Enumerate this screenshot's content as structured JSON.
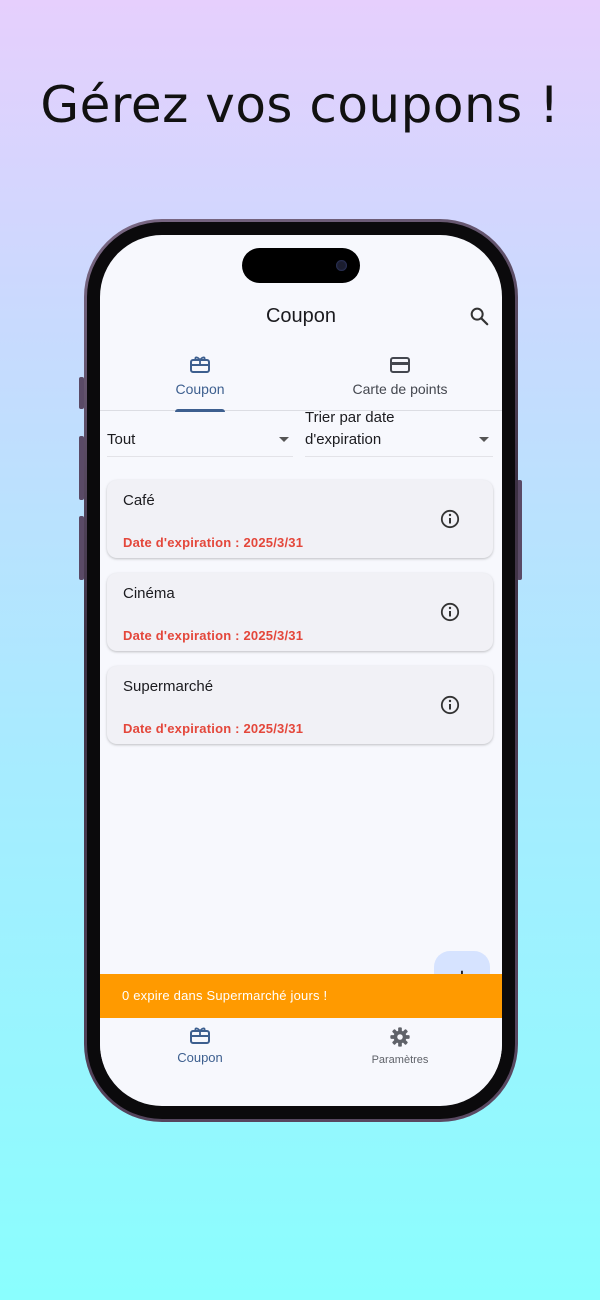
{
  "headline": "Gérez vos coupons !",
  "appbar": {
    "title": "Coupon",
    "search_icon": "search-icon"
  },
  "tabs": [
    {
      "label": "Coupon",
      "icon": "gift-card-icon",
      "active": true
    },
    {
      "label": "Carte de points",
      "icon": "credit-card-icon",
      "active": false
    }
  ],
  "filters": {
    "category": "Tout",
    "sort_line1": "Trier par date",
    "sort_line2": "d'expiration"
  },
  "coupons": [
    {
      "name": "Café",
      "expiration": "Date d'expiration : 2025/3/31"
    },
    {
      "name": "Cinéma",
      "expiration": "Date d'expiration : 2025/3/31"
    },
    {
      "name": "Supermarché",
      "expiration": "Date d'expiration : 2025/3/31"
    }
  ],
  "fab": {
    "label": "+"
  },
  "snackbar": {
    "message": "0 expire dans Supermarché jours !"
  },
  "bottom_nav": [
    {
      "label": "Coupon",
      "icon": "gift-card-icon",
      "active": true
    },
    {
      "label": "Paramètres",
      "icon": "gear-icon",
      "active": false
    }
  ],
  "colors": {
    "accent": "#3d5f8f",
    "expiration_text": "#e4473b",
    "snackbar": "#ff9a00",
    "fab": "#d6e3ff"
  }
}
